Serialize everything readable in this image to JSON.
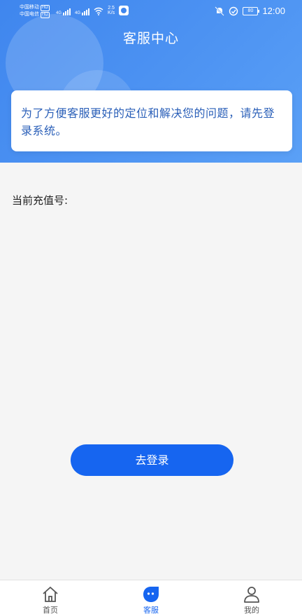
{
  "status_bar": {
    "carrier1": "中国移动",
    "carrier2": "中国电信",
    "hd_badge": "HD",
    "net1": "4G",
    "net2": "4G",
    "speed_value": "2.5",
    "speed_unit": "K/s",
    "battery": "80",
    "time": "12:00",
    "icons": [
      "signal-icon",
      "wifi-icon",
      "app-icon",
      "mute-icon",
      "data-saver-icon",
      "battery-icon"
    ]
  },
  "header": {
    "title": "客服中心",
    "gradient_start": "#3f86ee",
    "gradient_end": "#5aa0f6"
  },
  "notice": {
    "text": "为了方便客服更好的定位和解决您的问题，请先登录系统。"
  },
  "account": {
    "label": "当前充值号:"
  },
  "login_button": {
    "label": "去登录",
    "color": "#1665f0"
  },
  "tabbar": {
    "tabs": [
      {
        "label": "首页",
        "icon": "home-icon",
        "active": false
      },
      {
        "label": "客服",
        "icon": "customer-service-icon",
        "active": true
      },
      {
        "label": "我的",
        "icon": "user-icon",
        "active": false
      }
    ],
    "active_color": "#1665f0"
  }
}
